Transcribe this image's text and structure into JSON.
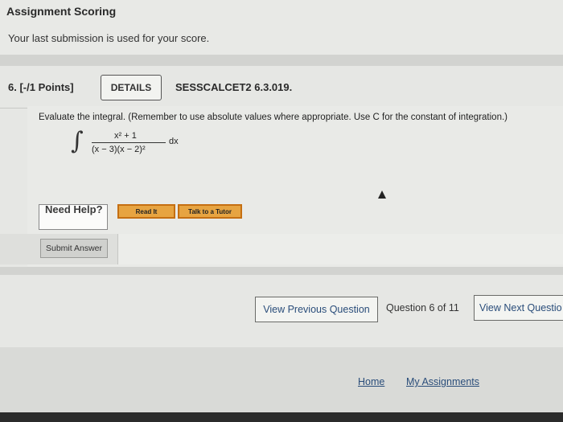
{
  "header": {
    "title": "Assignment Scoring",
    "subtitle": "Your last submission is used for your score."
  },
  "question": {
    "number_label": "6. [-/1 Points]",
    "details_label": "DETAILS",
    "code": "SESSCALCET2 6.3.019.",
    "prompt": "Evaluate the integral. (Remember to use absolute values where appropriate. Use C for the constant of integration.)",
    "integral": {
      "numerator": "x² + 1",
      "denominator": "(x − 3)(x − 2)²",
      "differential": "dx"
    },
    "answer_value": "",
    "need_help": "Need Help?",
    "read_it": "Read It",
    "talk_to_tutor": "Talk to a Tutor",
    "submit_label": "Submit Answer"
  },
  "navigation": {
    "prev_label": "View Previous Question",
    "position": "Question 6 of 11",
    "next_label": "View Next Questio"
  },
  "footer": {
    "home": "Home",
    "my_assignments": "My Assignments"
  }
}
